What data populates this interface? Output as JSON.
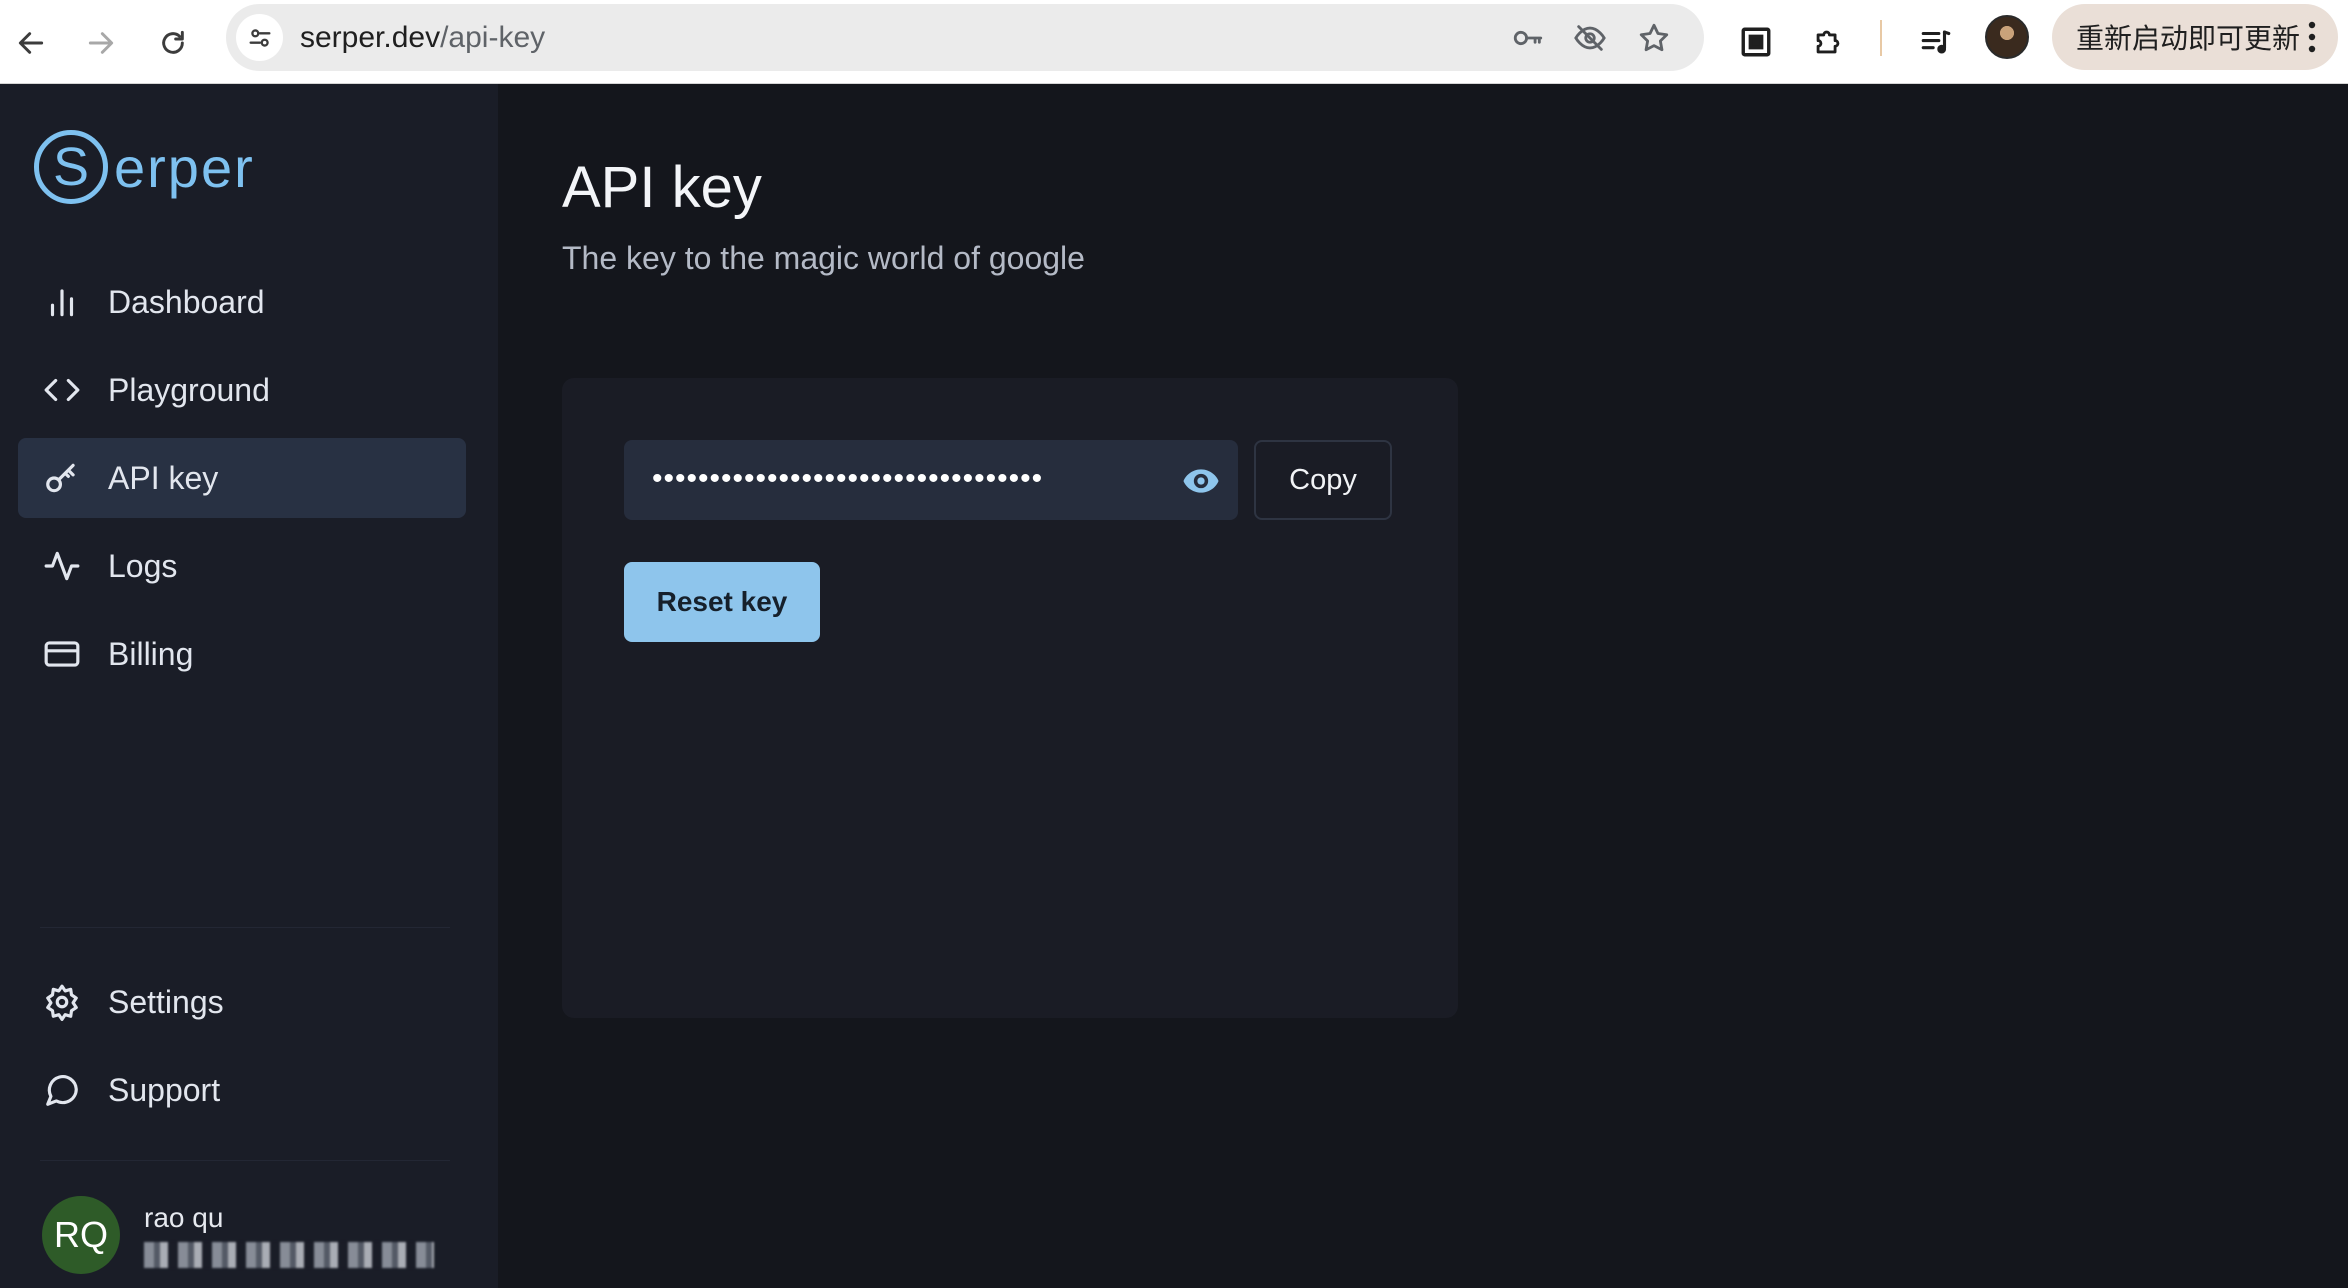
{
  "browser": {
    "url_domain": "serper.dev",
    "url_path": "/api-key",
    "update_button_label": "重新启动即可更新"
  },
  "sidebar": {
    "logo_letter": "S",
    "logo_text": "erper",
    "items": [
      {
        "label": "Dashboard",
        "icon": "bar-chart-icon"
      },
      {
        "label": "Playground",
        "icon": "code-icon"
      },
      {
        "label": "API key",
        "icon": "key-icon",
        "active": true
      },
      {
        "label": "Logs",
        "icon": "activity-icon"
      },
      {
        "label": "Billing",
        "icon": "credit-card-icon"
      }
    ],
    "bottom_items": [
      {
        "label": "Settings",
        "icon": "gear-icon"
      },
      {
        "label": "Support",
        "icon": "chat-bubble-icon"
      }
    ],
    "user": {
      "initials": "RQ",
      "name": "rao qu"
    }
  },
  "main": {
    "title": "API key",
    "subtitle": "The key to the magic world of google",
    "key_masked": "••••••••••••••••••••••••••••••••••",
    "copy_label": "Copy",
    "reset_label": "Reset key"
  },
  "colors": {
    "accent": "#8ec5ec",
    "logo": "#7ec1f0",
    "sidebar_bg": "#1a1d27",
    "main_bg": "#14161c",
    "active_item_bg": "#283143",
    "avatar_bg": "#2e5b28"
  }
}
